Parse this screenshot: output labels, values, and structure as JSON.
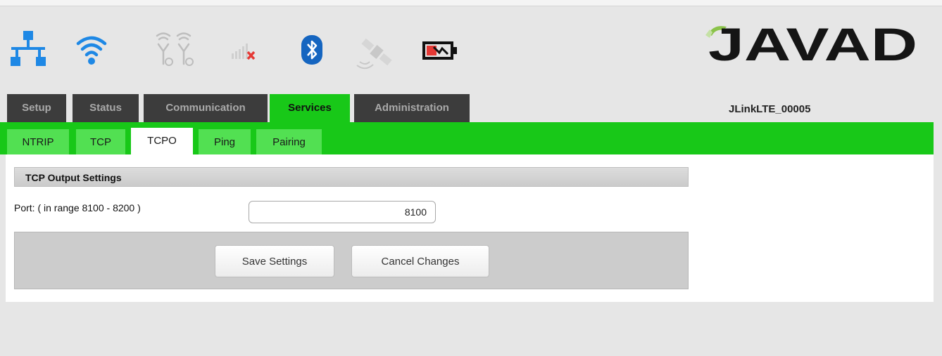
{
  "status_icons": [
    {
      "name": "network-icon",
      "color": "#1e88e5"
    },
    {
      "name": "wifi-icon",
      "color": "#1e88e5"
    },
    {
      "name": "dual-sim-icon",
      "color": "#bdbdbd"
    },
    {
      "name": "cellular-signal-off-icon",
      "color": "#cfcfcf"
    },
    {
      "name": "bluetooth-icon",
      "color": "#1565c0"
    },
    {
      "name": "satellite-icon",
      "color": "#c8c8c8"
    },
    {
      "name": "battery-charging-icon",
      "color": "#e53935"
    }
  ],
  "logo": {
    "text": "JAVAD",
    "color": "#151515",
    "accent": "#8bc34a"
  },
  "main_tabs": [
    {
      "label": "Setup",
      "active": false
    },
    {
      "label": "Status",
      "active": false
    },
    {
      "label": "Communication",
      "active": false
    },
    {
      "label": "Services",
      "active": true
    },
    {
      "label": "Administration",
      "active": false
    }
  ],
  "device_name": "JLinkLTE_00005",
  "sub_tabs": [
    {
      "label": "NTRIP",
      "active": false
    },
    {
      "label": "TCP",
      "active": false
    },
    {
      "label": "TCPO",
      "active": true
    },
    {
      "label": "Ping",
      "active": false
    },
    {
      "label": "Pairing",
      "active": false
    }
  ],
  "section": {
    "title": "TCP Output Settings",
    "port_label": "Port: ( in range 8100 - 8200 )",
    "port_value": "8100"
  },
  "buttons": {
    "save": "Save Settings",
    "cancel": "Cancel Changes"
  },
  "colors": {
    "accent_green": "#18c818",
    "tab_dark": "#3c3c3c",
    "background": "#e6e6e6"
  }
}
